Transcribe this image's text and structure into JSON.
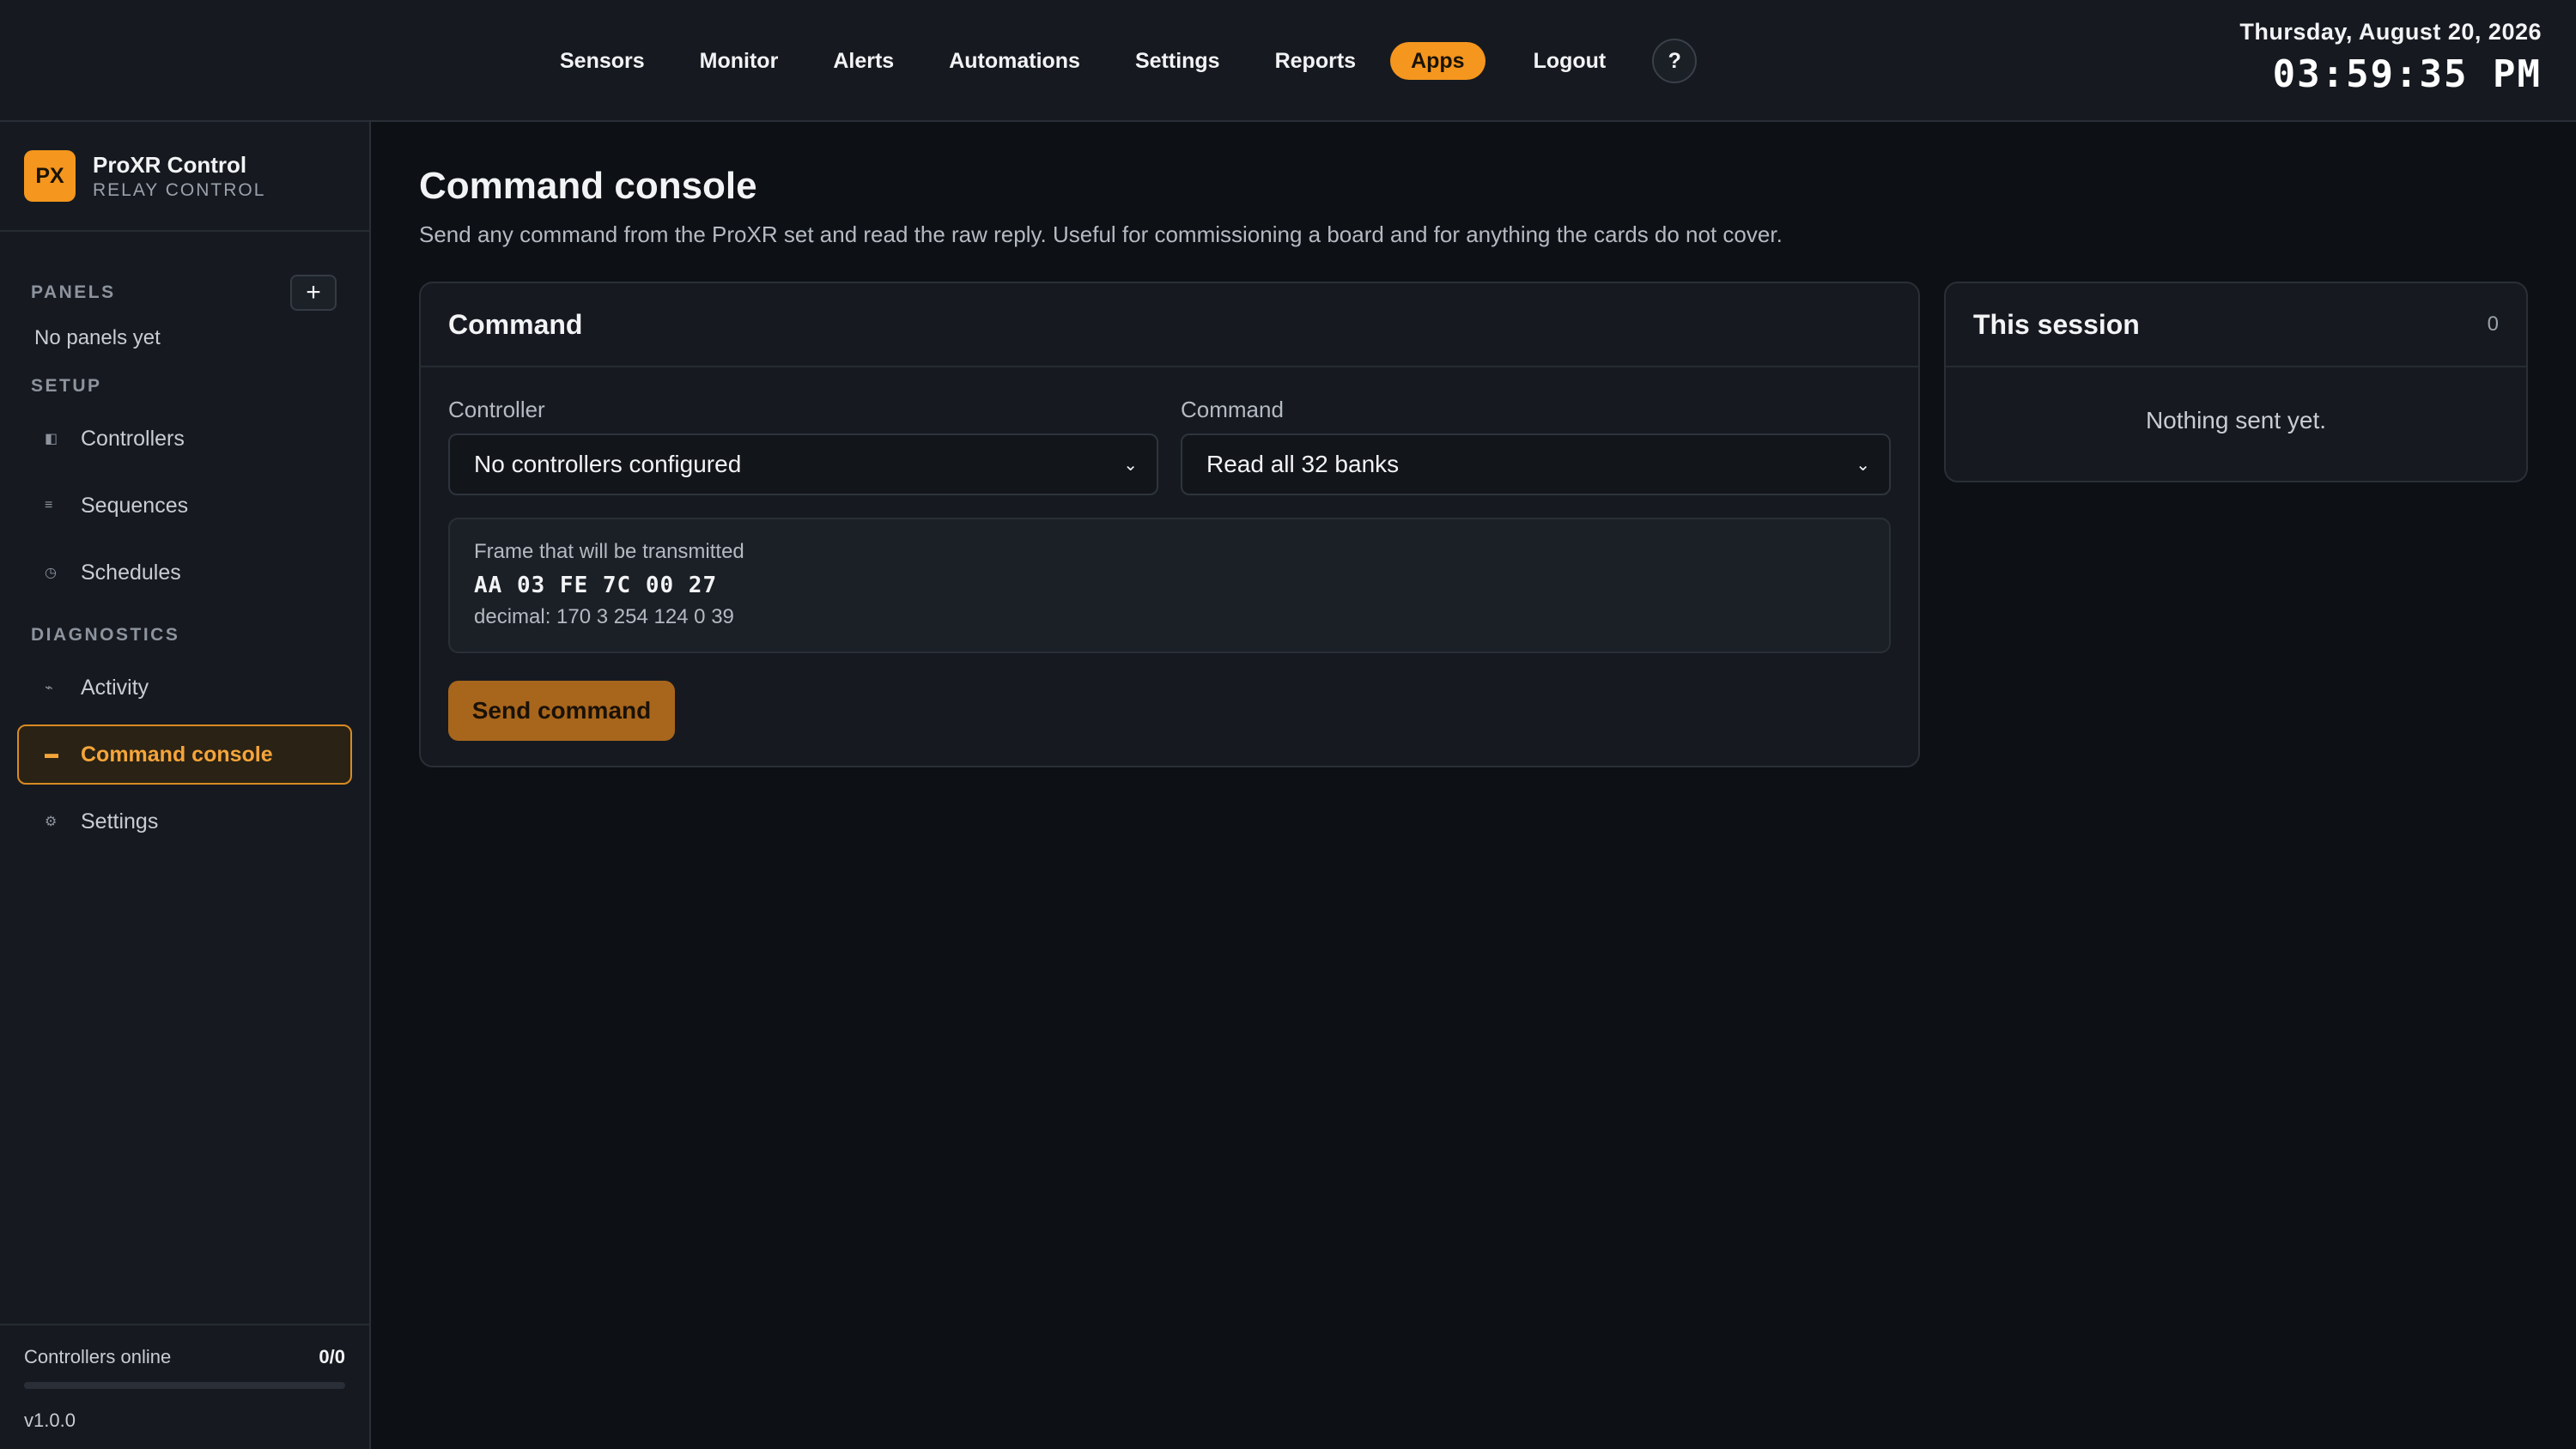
{
  "topnav": {
    "items": [
      "Sensors",
      "Monitor",
      "Alerts",
      "Automations",
      "Settings",
      "Reports"
    ],
    "active": "Apps",
    "logout": "Logout",
    "help": "?"
  },
  "clock": {
    "date": "Thursday, August 20, 2026",
    "time": "03:59:35 PM"
  },
  "brand": {
    "logo": "PX",
    "title": "ProXR Control",
    "subtitle": "RELAY CONTROL"
  },
  "sidebar": {
    "panels_label": "PANELS",
    "add_symbol": "+",
    "panels_empty": "No panels yet",
    "setup_label": "SETUP",
    "setup_items": [
      {
        "label": "Controllers",
        "icon": "controller-icon",
        "glyph": "◧"
      },
      {
        "label": "Sequences",
        "icon": "list-icon",
        "glyph": "≡"
      },
      {
        "label": "Schedules",
        "icon": "clock-icon",
        "glyph": "◷"
      }
    ],
    "diagnostics_label": "DIAGNOSTICS",
    "diagnostics_items": [
      {
        "label": "Activity",
        "icon": "activity-icon",
        "glyph": "⌁"
      },
      {
        "label": "Command console",
        "icon": "console-icon",
        "glyph": "▬",
        "active": true
      },
      {
        "label": "Settings",
        "icon": "gear-icon",
        "glyph": "⚙"
      }
    ],
    "footer": {
      "online_label": "Controllers online",
      "online_value": "0/0",
      "online_fraction": 0,
      "version": "v1.0.0"
    }
  },
  "page": {
    "title": "Command console",
    "description": "Send any command from the ProXR set and read the raw reply. Useful for commissioning a board and for anything the cards do not cover."
  },
  "command_card": {
    "title": "Command",
    "controller_label": "Controller",
    "controller_value": "No controllers configured",
    "command_label": "Command",
    "command_value": "Read all 32 banks",
    "frame_label": "Frame that will be transmitted",
    "frame_hex": "AA 03 FE 7C 00 27",
    "frame_decimal": "decimal: 170 3 254 124 0 39",
    "send_label": "Send command"
  },
  "session_card": {
    "title": "This session",
    "count": "0",
    "empty": "Nothing sent yet."
  },
  "colors": {
    "accent": "#f5961e",
    "background": "#0d1015",
    "surface": "#161a20"
  }
}
